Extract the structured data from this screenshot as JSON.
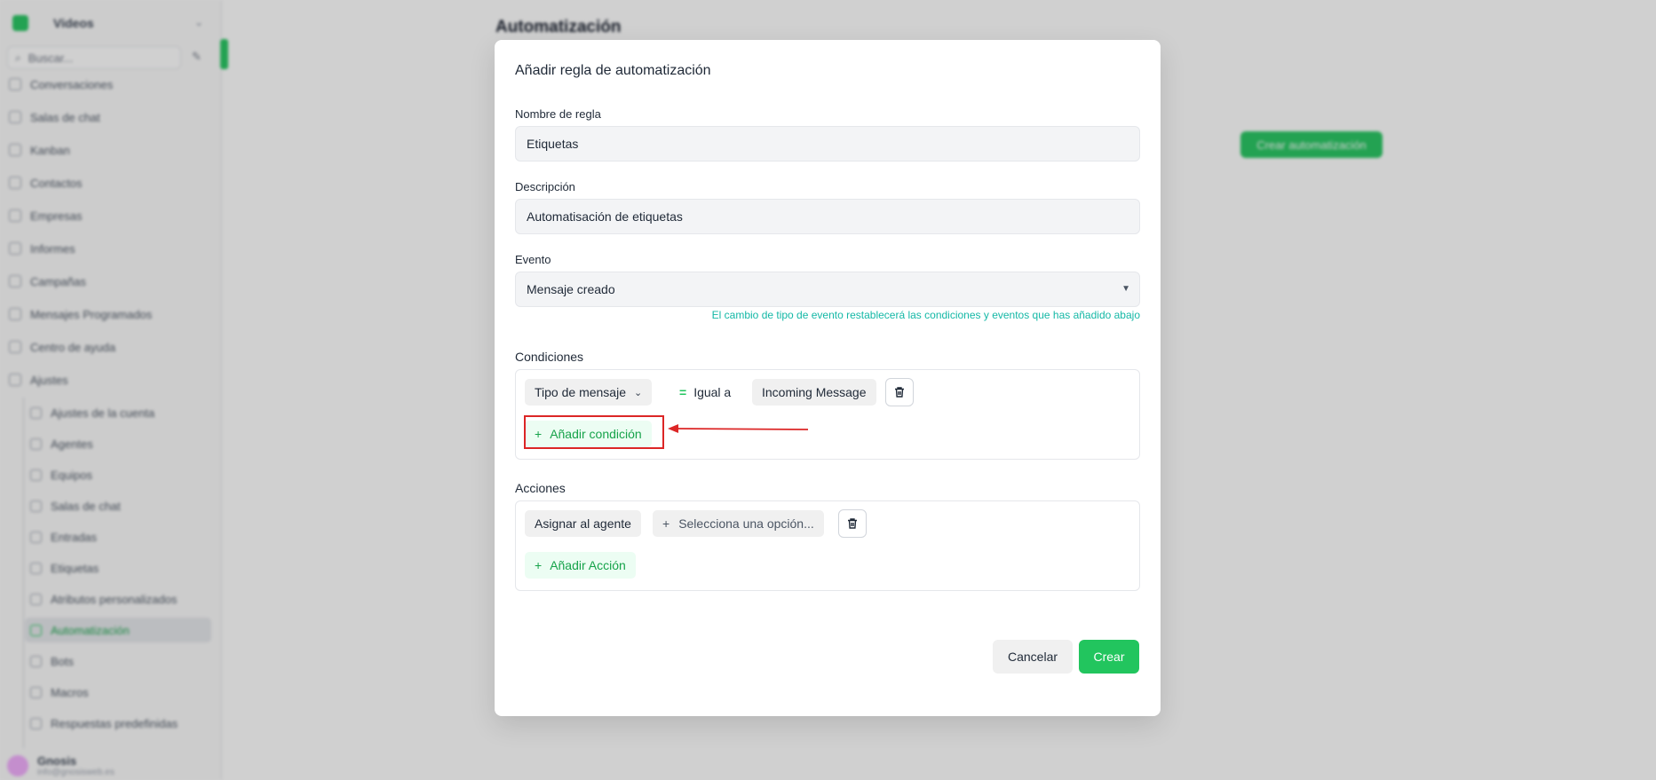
{
  "sidebar": {
    "workspace": "Videos",
    "search_placeholder": "Buscar...",
    "items": [
      {
        "label": "Conversaciones"
      },
      {
        "label": "Salas de chat"
      },
      {
        "label": "Kanban"
      },
      {
        "label": "Contactos"
      },
      {
        "label": "Empresas"
      },
      {
        "label": "Informes"
      },
      {
        "label": "Campañas"
      },
      {
        "label": "Mensajes Programados"
      },
      {
        "label": "Centro de ayuda"
      },
      {
        "label": "Ajustes"
      }
    ],
    "settings_items": [
      {
        "label": "Ajustes de la cuenta"
      },
      {
        "label": "Agentes"
      },
      {
        "label": "Equipos"
      },
      {
        "label": "Salas de chat"
      },
      {
        "label": "Entradas"
      },
      {
        "label": "Etiquetas"
      },
      {
        "label": "Atributos personalizados"
      },
      {
        "label": "Automatización"
      },
      {
        "label": "Bots"
      },
      {
        "label": "Macros"
      },
      {
        "label": "Respuestas predefinidas"
      }
    ],
    "user": {
      "name": "Gnosis",
      "email": "info@gnosisweb.es"
    }
  },
  "main": {
    "title": "Automatización",
    "create_button": "Crear automatización"
  },
  "modal": {
    "title": "Añadir regla de automatización",
    "rule_name_label": "Nombre de regla",
    "rule_name_value": "Etiquetas",
    "description_label": "Descripción",
    "description_value": "Automatisación de etiquetas",
    "event_label": "Evento",
    "event_value": "Mensaje creado",
    "event_hint": "El cambio de tipo de evento restablecerá las condiciones y eventos que has añadido abajo",
    "conditions_label": "Condiciones",
    "condition": {
      "attribute": "Tipo de mensaje",
      "operator": "Igual a",
      "value": "Incoming Message"
    },
    "add_condition": "Añadir condición",
    "actions_label": "Acciones",
    "action": {
      "type": "Asignar al agente",
      "value_placeholder": "Selecciona una opción..."
    },
    "add_action": "Añadir Acción",
    "cancel": "Cancelar",
    "create": "Crear"
  },
  "colors": {
    "accent": "#22c55e",
    "hint": "#14b8a6",
    "annotation": "#dc2626"
  }
}
